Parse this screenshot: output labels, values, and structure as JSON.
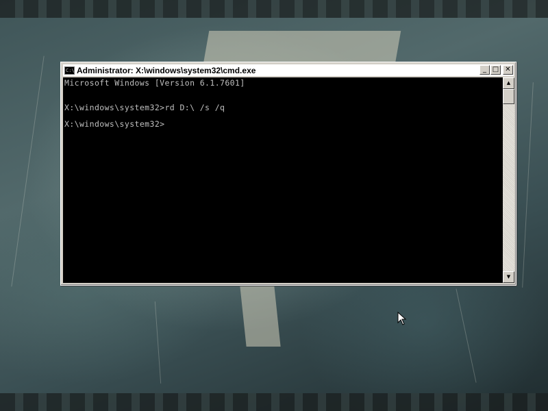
{
  "window": {
    "title": "Administrator: X:\\windows\\system32\\cmd.exe",
    "icon": "cmd-icon",
    "icon_glyph": "C:\\",
    "buttons": {
      "minimize": "_",
      "maximize": "□",
      "close": "✕"
    }
  },
  "console": {
    "lines": [
      "Microsoft Windows [Version 6.1.7601]",
      "",
      "X:\\windows\\system32>rd D:\\ /s /q",
      "",
      "X:\\windows\\system32>"
    ],
    "text_color": "#c0c0c0",
    "background_color": "#000000"
  },
  "scrollbar": {
    "up_arrow": "▲",
    "down_arrow": "▼"
  },
  "desktop": {
    "background": "grunge-teal-wallpaper"
  }
}
